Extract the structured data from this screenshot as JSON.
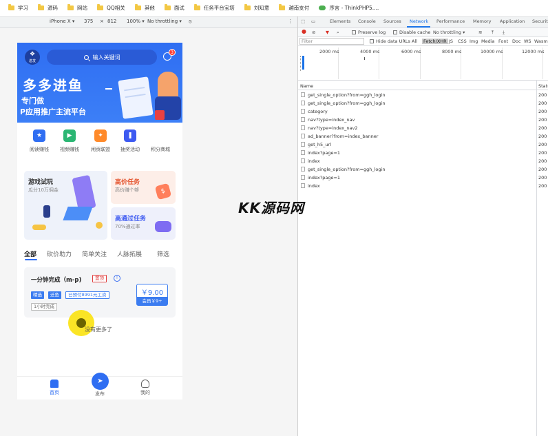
{
  "bookmarks": [
    {
      "label": "学习"
    },
    {
      "label": "源码"
    },
    {
      "label": "网站"
    },
    {
      "label": "QQ相关"
    },
    {
      "label": "其他"
    },
    {
      "label": "面试"
    },
    {
      "label": "任务平台宝塔"
    },
    {
      "label": "刘知意"
    },
    {
      "label": "越南支付"
    }
  ],
  "bookmark_tab": "序言 - ThinkPHP5....",
  "emulation": {
    "device": "iPhone X ▾",
    "width": "375",
    "times": "×",
    "height": "812",
    "zoom": "100% ▾",
    "throttle": "No throttling ▾"
  },
  "app": {
    "logo_text": "进发",
    "search_placeholder": "输入关键词",
    "msg_badge": "3",
    "banner_title": "多多进鱼",
    "banner_line1": "专门做",
    "banner_line2": "P应用推广主流平台",
    "icons": [
      {
        "label": "阅读赚钱",
        "color": "#2f6ef2",
        "glyph": "★"
      },
      {
        "label": "视频赚钱",
        "color": "#2bb673",
        "glyph": "▶"
      },
      {
        "label": "闲贡联盟",
        "color": "#ff8a2a",
        "glyph": "✦"
      },
      {
        "label": "抽奖活动",
        "color": "#3d5af1",
        "glyph": "❚"
      },
      {
        "label": "积分商城",
        "color": "#ffffff",
        "glyph": ""
      }
    ],
    "game_card": {
      "title": "游戏试玩",
      "sub": "瓜分10万佣金"
    },
    "high_card": {
      "title": "高价任务",
      "sub": "高价赚个够",
      "badge": "$"
    },
    "pass_card": {
      "title": "高通过任务",
      "sub": "70%通过率"
    },
    "tabs": [
      "全部",
      "砍价助力",
      "简单关注",
      "人脉拓展",
      "筛选"
    ],
    "task": {
      "title": "一分钟完成（m-p)",
      "tag": "置顶",
      "info": "!",
      "chips": [
        "精选",
        "迁鱼",
        "已预付8991元工资"
      ],
      "time_chip": "1小时完成",
      "price": "￥9.00",
      "vip": "会员￥9+"
    },
    "no_more": "没有更多了",
    "tabbar": [
      "首页",
      "发布",
      "我的"
    ],
    "fab_icon": "send-icon"
  },
  "devtools": {
    "tabs": [
      "Elements",
      "Console",
      "Sources",
      "Network",
      "Performance",
      "Memory",
      "Application",
      "Security"
    ],
    "active_tab": "Network",
    "toolbar": {
      "preserve_log": "Preserve log",
      "disable_cache": "Disable cache",
      "throttle": "No throttling"
    },
    "filter": {
      "placeholder": "Filter",
      "hide_data": "Hide data URLs",
      "types": [
        "All",
        "Fetch/XHR",
        "JS",
        "CSS",
        "Img",
        "Media",
        "Font",
        "Doc",
        "WS",
        "Wasm"
      ]
    },
    "ticks": [
      "2000 ms",
      "4000 ms",
      "6000 ms",
      "8000 ms",
      "10000 ms",
      "12000 ms"
    ],
    "columns": {
      "name": "Name",
      "status": "Status"
    },
    "requests": [
      {
        "name": "get_single_option?from=ggh_login",
        "status": "200"
      },
      {
        "name": "get_single_option?from=ggh_login",
        "status": "200"
      },
      {
        "name": "category",
        "status": "200"
      },
      {
        "name": "nav?type=index_nav",
        "status": "200"
      },
      {
        "name": "nav?type=index_nav2",
        "status": "200"
      },
      {
        "name": "ad_banner?from=index_banner",
        "status": "200"
      },
      {
        "name": "get_h5_url",
        "status": "200"
      },
      {
        "name": "index?page=1",
        "status": "200"
      },
      {
        "name": "index",
        "status": "200"
      },
      {
        "name": "get_single_option?from=ggh_login",
        "status": "200"
      },
      {
        "name": "index?page=1",
        "status": "200"
      },
      {
        "name": "index",
        "status": "200"
      }
    ]
  },
  "watermark": "KK源码网"
}
